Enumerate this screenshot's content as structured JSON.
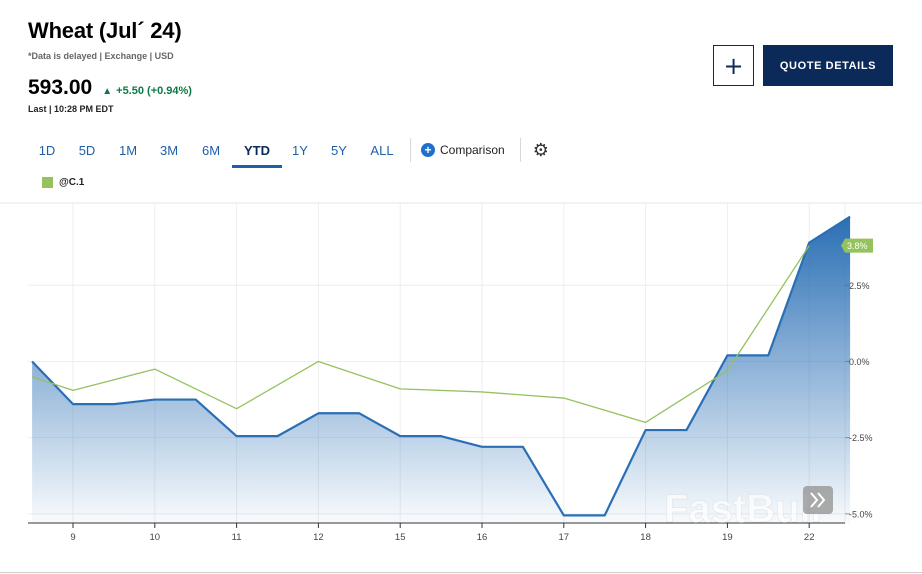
{
  "header": {
    "title": "Wheat (Jul´ 24)",
    "subtitle": "*Data is delayed | Exchange | USD",
    "price": "593.00",
    "change": "+5.50 (+0.94%)",
    "last": "Last | 10:28 PM EDT"
  },
  "actions": {
    "plus_label": "+",
    "quote_details_label": "QUOTE DETAILS"
  },
  "tabs": [
    {
      "label": "1D",
      "active": false
    },
    {
      "label": "5D",
      "active": false
    },
    {
      "label": "1M",
      "active": false
    },
    {
      "label": "3M",
      "active": false
    },
    {
      "label": "6M",
      "active": false
    },
    {
      "label": "YTD",
      "active": true
    },
    {
      "label": "1Y",
      "active": false
    },
    {
      "label": "5Y",
      "active": false
    },
    {
      "label": "ALL",
      "active": false
    }
  ],
  "toolbar": {
    "comparison_label": "Comparison",
    "settings_icon": "gear-icon"
  },
  "legend": {
    "label": "@C.1",
    "color": "#94c25f"
  },
  "watermark": {
    "text": "FastBull"
  },
  "colors": {
    "main_series": "#2a6fb5",
    "comparison_series": "#94c25f",
    "navy": "#0b2a5a",
    "positive": "#0b7a45"
  },
  "chart_data": {
    "type": "area",
    "x": [
      "9",
      "10",
      "11",
      "12",
      "15",
      "16",
      "17",
      "18",
      "19",
      "22"
    ],
    "y_ticks": [
      "2.5%",
      "0.0%",
      "-2.5%",
      "-5.0%"
    ],
    "y_tick_values": [
      2.5,
      0.0,
      -2.5,
      -5.0
    ],
    "ylim": [
      -5.3,
      5.2
    ],
    "main_series": {
      "points": [
        [
          -0.5,
          0.0
        ],
        [
          0.0,
          -1.4
        ],
        [
          0.5,
          -1.4
        ],
        [
          1.0,
          -1.25
        ],
        [
          1.5,
          -1.25
        ],
        [
          2.0,
          -2.45
        ],
        [
          2.5,
          -2.45
        ],
        [
          3.0,
          -1.7
        ],
        [
          3.5,
          -1.7
        ],
        [
          4.0,
          -2.45
        ],
        [
          4.5,
          -2.45
        ],
        [
          5.0,
          -2.8
        ],
        [
          5.5,
          -2.8
        ],
        [
          6.0,
          -5.05
        ],
        [
          6.5,
          -5.05
        ],
        [
          7.0,
          -2.25
        ],
        [
          7.5,
          -2.25
        ],
        [
          8.0,
          0.2
        ],
        [
          8.5,
          0.2
        ],
        [
          9.0,
          3.9
        ],
        [
          9.5,
          4.75
        ]
      ]
    },
    "comparison_series": {
      "name": "@C.1",
      "points": [
        [
          -0.5,
          -0.5
        ],
        [
          0.0,
          -0.95
        ],
        [
          1.0,
          -0.25
        ],
        [
          2.0,
          -1.55
        ],
        [
          3.0,
          0.0
        ],
        [
          4.0,
          -0.9
        ],
        [
          5.0,
          -1.0
        ],
        [
          6.0,
          -1.2
        ],
        [
          7.0,
          -2.0
        ],
        [
          8.0,
          -0.3
        ],
        [
          9.0,
          3.8
        ]
      ]
    },
    "end_labels": [
      {
        "text": "3.8%",
        "value": 3.8,
        "color": "#94c25f"
      }
    ]
  }
}
